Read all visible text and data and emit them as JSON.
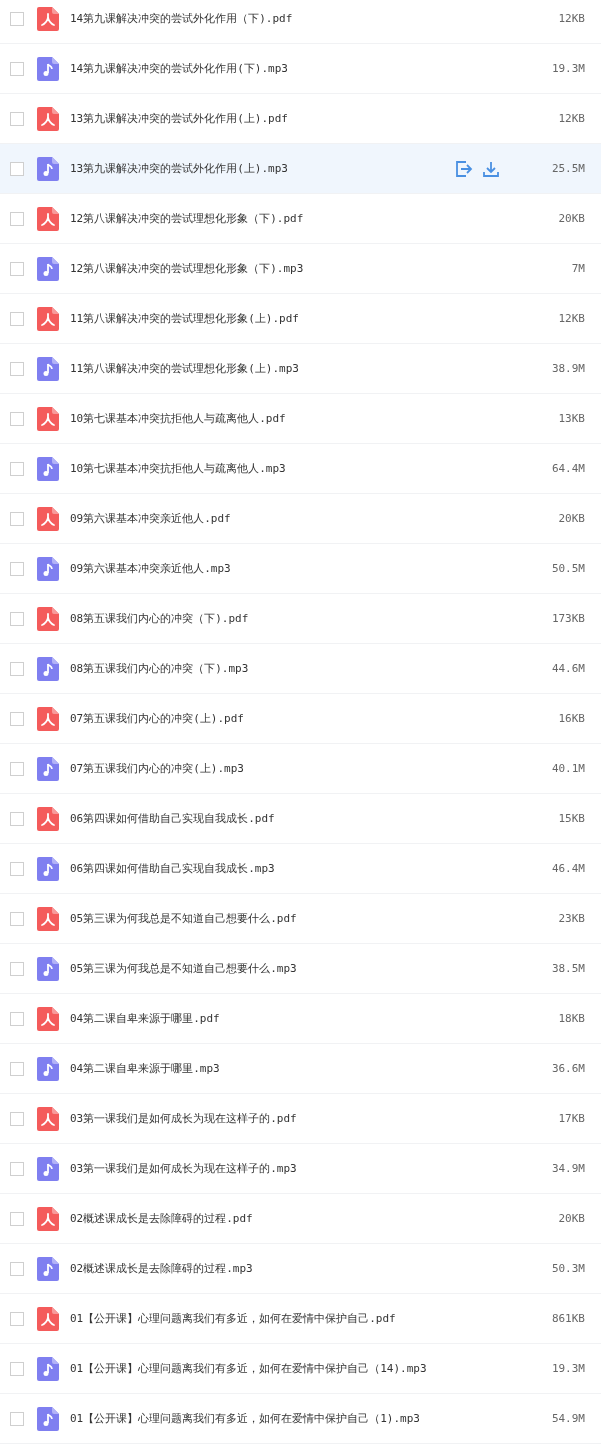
{
  "files": [
    {
      "name": "14第九课解决冲突的尝试外化作用（下).pdf",
      "kind": "pdf",
      "size": "12KB",
      "checked": false,
      "hovered": false
    },
    {
      "name": "14第九课解决冲突的尝试外化作用(下).mp3",
      "kind": "mp3",
      "size": "19.3M",
      "checked": false,
      "hovered": false
    },
    {
      "name": "13第九课解决冲突的尝试外化作用(上).pdf",
      "kind": "pdf",
      "size": "12KB",
      "checked": false,
      "hovered": false
    },
    {
      "name": "13第九课解决冲突的尝试外化作用(上).mp3",
      "kind": "mp3",
      "size": "25.5M",
      "checked": false,
      "hovered": true
    },
    {
      "name": "12第八课解决冲突的尝试理想化形象（下).pdf",
      "kind": "pdf",
      "size": "20KB",
      "checked": false,
      "hovered": false
    },
    {
      "name": "12第八课解决冲突的尝试理想化形象（下).mp3",
      "kind": "mp3",
      "size": "7M",
      "checked": false,
      "hovered": false
    },
    {
      "name": "11第八课解决冲突的尝试理想化形象(上).pdf",
      "kind": "pdf",
      "size": "12KB",
      "checked": false,
      "hovered": false
    },
    {
      "name": "11第八课解决冲突的尝试理想化形象(上).mp3",
      "kind": "mp3",
      "size": "38.9M",
      "checked": false,
      "hovered": false
    },
    {
      "name": "10第七课基本冲突抗拒他人与疏离他人.pdf",
      "kind": "pdf",
      "size": "13KB",
      "checked": false,
      "hovered": false
    },
    {
      "name": "10第七课基本冲突抗拒他人与疏离他人.mp3",
      "kind": "mp3",
      "size": "64.4M",
      "checked": false,
      "hovered": false
    },
    {
      "name": "09第六课基本冲突亲近他人.pdf",
      "kind": "pdf",
      "size": "20KB",
      "checked": false,
      "hovered": false
    },
    {
      "name": "09第六课基本冲突亲近他人.mp3",
      "kind": "mp3",
      "size": "50.5M",
      "checked": false,
      "hovered": false
    },
    {
      "name": "08第五课我们内心的冲突（下).pdf",
      "kind": "pdf",
      "size": "173KB",
      "checked": false,
      "hovered": false
    },
    {
      "name": "08第五课我们内心的冲突（下).mp3",
      "kind": "mp3",
      "size": "44.6M",
      "checked": false,
      "hovered": false
    },
    {
      "name": "07第五课我们内心的冲突(上).pdf",
      "kind": "pdf",
      "size": "16KB",
      "checked": false,
      "hovered": false
    },
    {
      "name": "07第五课我们内心的冲突(上).mp3",
      "kind": "mp3",
      "size": "40.1M",
      "checked": false,
      "hovered": false
    },
    {
      "name": "06第四课如何借助自己实现自我成长.pdf",
      "kind": "pdf",
      "size": "15KB",
      "checked": false,
      "hovered": false
    },
    {
      "name": "06第四课如何借助自己实现自我成长.mp3",
      "kind": "mp3",
      "size": "46.4M",
      "checked": false,
      "hovered": false
    },
    {
      "name": "05第三课为何我总是不知道自己想要什么.pdf",
      "kind": "pdf",
      "size": "23KB",
      "checked": false,
      "hovered": false
    },
    {
      "name": "05第三课为何我总是不知道自己想要什么.mp3",
      "kind": "mp3",
      "size": "38.5M",
      "checked": false,
      "hovered": false
    },
    {
      "name": "04第二课自卑来源于哪里.pdf",
      "kind": "pdf",
      "size": "18KB",
      "checked": false,
      "hovered": false
    },
    {
      "name": "04第二课自卑来源于哪里.mp3",
      "kind": "mp3",
      "size": "36.6M",
      "checked": false,
      "hovered": false
    },
    {
      "name": "03第一课我们是如何成长为现在这样子的.pdf",
      "kind": "pdf",
      "size": "17KB",
      "checked": false,
      "hovered": false
    },
    {
      "name": "03第一课我们是如何成长为现在这样子的.mp3",
      "kind": "mp3",
      "size": "34.9M",
      "checked": false,
      "hovered": false
    },
    {
      "name": "02概述课成长是去除障碍的过程.pdf",
      "kind": "pdf",
      "size": "20KB",
      "checked": false,
      "hovered": false
    },
    {
      "name": "02概述课成长是去除障碍的过程.mp3",
      "kind": "mp3",
      "size": "50.3M",
      "checked": false,
      "hovered": false
    },
    {
      "name": "01【公开课】心理问题离我们有多近，如何在爱情中保护自己.pdf",
      "kind": "pdf",
      "size": "861KB",
      "checked": false,
      "hovered": false
    },
    {
      "name": "01【公开课】心理问题离我们有多近，如何在爱情中保护自己（14).mp3",
      "kind": "mp3",
      "size": "19.3M",
      "checked": false,
      "hovered": false
    },
    {
      "name": "01【公开课】心理问题离我们有多近，如何在爱情中保护自己（1).mp3",
      "kind": "mp3",
      "size": "54.9M",
      "checked": false,
      "hovered": false
    }
  ]
}
